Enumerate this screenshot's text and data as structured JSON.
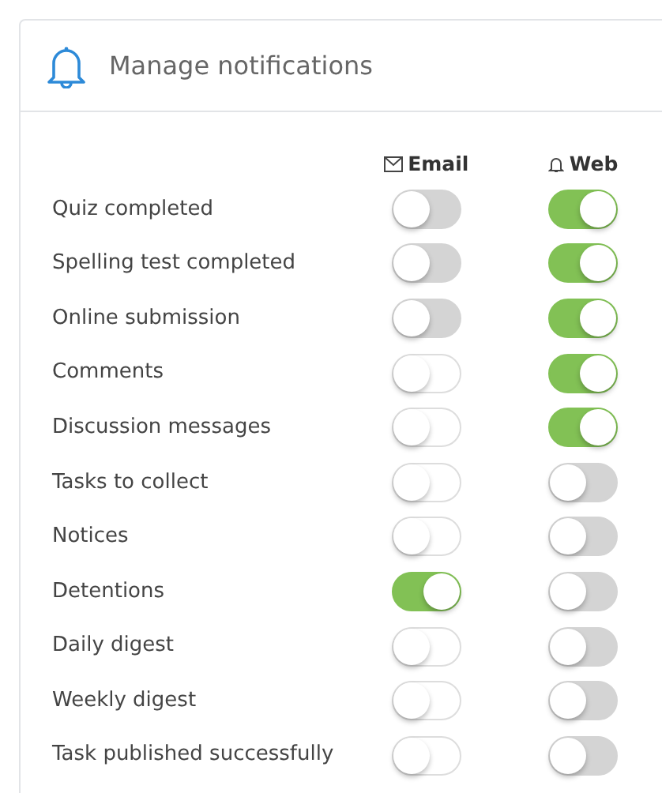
{
  "title": "Manage notifications",
  "columns": [
    {
      "kind": "email",
      "label": "Email"
    },
    {
      "kind": "web",
      "label": "Web"
    }
  ],
  "rows": [
    {
      "label": "Quiz completed",
      "email": {
        "on": false,
        "disabled": true
      },
      "web": {
        "on": true,
        "disabled": false
      }
    },
    {
      "label": "Spelling test completed",
      "email": {
        "on": false,
        "disabled": true
      },
      "web": {
        "on": true,
        "disabled": false
      }
    },
    {
      "label": "Online submission",
      "email": {
        "on": false,
        "disabled": true
      },
      "web": {
        "on": true,
        "disabled": false
      }
    },
    {
      "label": "Comments",
      "email": {
        "on": false,
        "disabled": false
      },
      "web": {
        "on": true,
        "disabled": false
      }
    },
    {
      "label": "Discussion messages",
      "email": {
        "on": false,
        "disabled": false
      },
      "web": {
        "on": true,
        "disabled": false
      }
    },
    {
      "label": "Tasks to collect",
      "email": {
        "on": false,
        "disabled": false
      },
      "web": {
        "on": false,
        "disabled": true
      }
    },
    {
      "label": "Notices",
      "email": {
        "on": false,
        "disabled": false
      },
      "web": {
        "on": false,
        "disabled": true
      }
    },
    {
      "label": "Detentions",
      "email": {
        "on": true,
        "disabled": false
      },
      "web": {
        "on": false,
        "disabled": true
      }
    },
    {
      "label": "Daily digest",
      "email": {
        "on": false,
        "disabled": false
      },
      "web": {
        "on": false,
        "disabled": true
      }
    },
    {
      "label": "Weekly digest",
      "email": {
        "on": false,
        "disabled": false
      },
      "web": {
        "on": false,
        "disabled": true
      }
    },
    {
      "label": "Task published successfully",
      "email": {
        "on": false,
        "disabled": false
      },
      "web": {
        "on": false,
        "disabled": true
      }
    }
  ]
}
